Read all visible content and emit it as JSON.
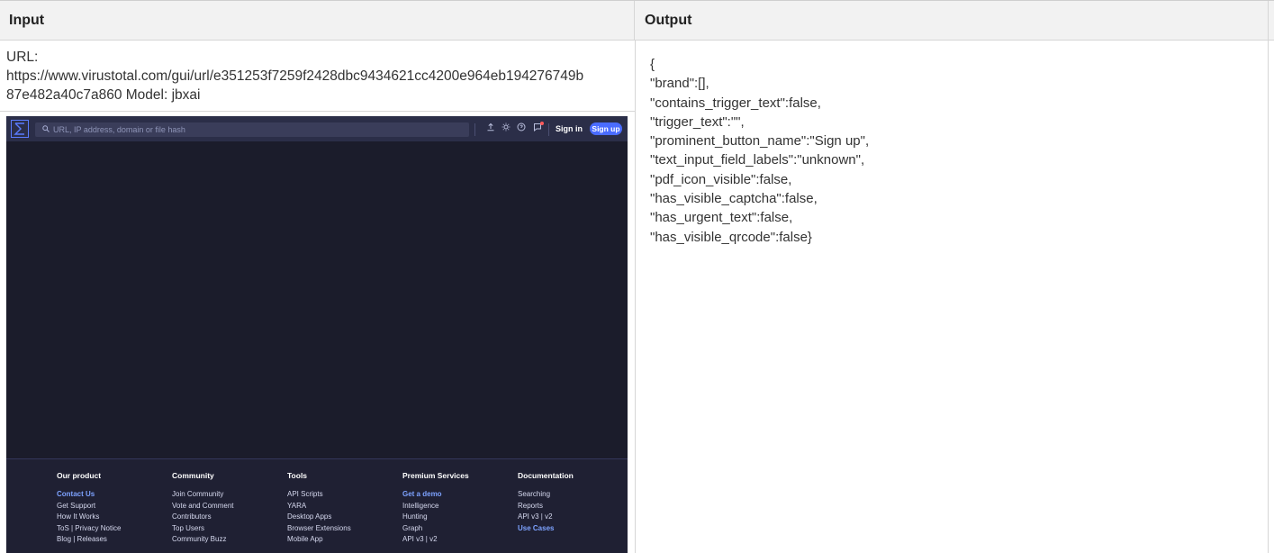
{
  "header": {
    "input": "Input",
    "output": "Output"
  },
  "input_panel": {
    "url_prefix": "URL:",
    "url_line1": "https://www.virustotal.com/gui/url/e351253f7259f2428dbc9434621cc4200e964eb194276749b",
    "url_line2": "87e482a40c7a860 Model: jbxai"
  },
  "screenshot": {
    "search_placeholder": "URL, IP address, domain or file hash",
    "signin_label": "Sign in",
    "signup_label": "Sign up",
    "icons": [
      "sigma-logo-icon",
      "search-icon",
      "upload-icon",
      "notification-icon",
      "help-icon",
      "theme-icon"
    ],
    "footer": [
      {
        "title": "Our product",
        "links": [
          {
            "text": "Contact Us",
            "accent": true
          },
          {
            "text": "Get Support",
            "accent": false
          },
          {
            "text": "How It Works",
            "accent": false
          },
          {
            "text": "ToS | Privacy Notice",
            "accent": false
          },
          {
            "text": "Blog | Releases",
            "accent": false
          }
        ]
      },
      {
        "title": "Community",
        "links": [
          {
            "text": "Join Community",
            "accent": false
          },
          {
            "text": "Vote and Comment",
            "accent": false
          },
          {
            "text": "Contributors",
            "accent": false
          },
          {
            "text": "Top Users",
            "accent": false
          },
          {
            "text": "Community Buzz",
            "accent": false
          }
        ]
      },
      {
        "title": "Tools",
        "links": [
          {
            "text": "API Scripts",
            "accent": false
          },
          {
            "text": "YARA",
            "accent": false
          },
          {
            "text": "Desktop Apps",
            "accent": false
          },
          {
            "text": "Browser Extensions",
            "accent": false
          },
          {
            "text": "Mobile App",
            "accent": false
          }
        ]
      },
      {
        "title": "Premium Services",
        "links": [
          {
            "text": "Get a demo",
            "accent": true
          },
          {
            "text": "Intelligence",
            "accent": false
          },
          {
            "text": "Hunting",
            "accent": false
          },
          {
            "text": "Graph",
            "accent": false
          },
          {
            "text": "API v3 | v2",
            "accent": false
          }
        ]
      },
      {
        "title": "Documentation",
        "links": [
          {
            "text": "Searching",
            "accent": false
          },
          {
            "text": "Reports",
            "accent": false
          },
          {
            "text": "API v3 | v2",
            "accent": false
          },
          {
            "text": "Use Cases",
            "accent": true
          }
        ]
      }
    ]
  },
  "output_panel": {
    "lines": [
      "{",
      "\"brand\":[],",
      "\"contains_trigger_text\":false,",
      "\"trigger_text\":\"\",",
      "\"prominent_button_name\":\"Sign up\",",
      "\"text_input_field_labels\":\"unknown\",",
      "\"pdf_icon_visible\":false,",
      "\"has_visible_captcha\":false,",
      "\"has_urgent_text\":false,",
      "\"has_visible_qrcode\":false}"
    ]
  },
  "colors": {
    "page_bg": "#1b1c2b",
    "topbar_bg": "#2b2e48",
    "accent": "#4a6cff",
    "link_accent": "#7da2ff"
  }
}
